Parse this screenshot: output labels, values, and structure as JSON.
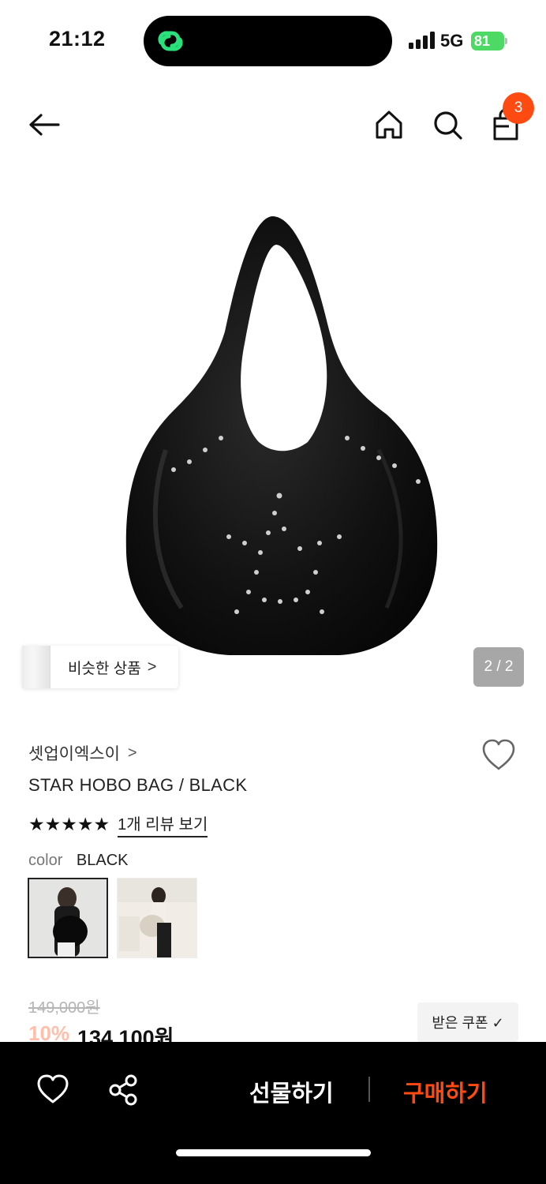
{
  "status_bar": {
    "time": "21:12",
    "network": "5G",
    "battery": "81",
    "icons": [
      "signal-icon",
      "battery-charging-icon",
      "app-link-icon"
    ]
  },
  "header": {
    "icons": [
      "back-arrow-icon",
      "home-icon",
      "search-icon",
      "shopping-bag-icon"
    ],
    "cart_count": "3"
  },
  "gallery": {
    "similar_label": "비슷한 상품",
    "similar_chevron": ">",
    "page_indicator": "2 / 2"
  },
  "product": {
    "brand": "셋업이엑스이",
    "brand_chevron": ">",
    "title": "STAR HOBO BAG / BLACK",
    "stars": "★★★★★",
    "rating": 5,
    "review_link": "1개 리뷰 보기",
    "color_key": "color",
    "color_value": "BLACK"
  },
  "price": {
    "original": "149,000원",
    "discount": "10%",
    "sale": "134,100원",
    "coupon_label": "받은 쿠폰 ✓"
  },
  "bottom_bar": {
    "gift_label": "선물하기",
    "buy_label": "구매하기"
  },
  "colors": {
    "accent": "#ff4b12",
    "battery": "#4cd964",
    "bottom_bar": "#000000"
  }
}
